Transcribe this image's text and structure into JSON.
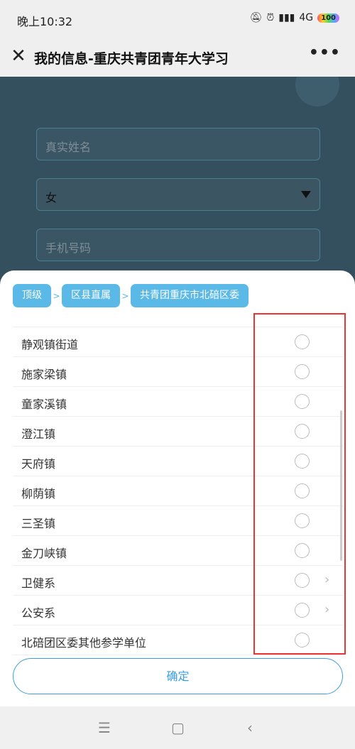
{
  "status": {
    "time": "晚上10:32",
    "network": "4G",
    "battery": "100"
  },
  "nav": {
    "title": "我的信息-重庆共青团青年大学习",
    "more": "•••"
  },
  "form": {
    "name_placeholder": "真实姓名",
    "gender_value": "女",
    "phone_placeholder": "手机号码"
  },
  "breadcrumbs": [
    "顶级",
    "区县直属",
    "共青团重庆市北碚区委"
  ],
  "breadcrumb_sep": ">",
  "list": [
    {
      "label": "静观镇街道",
      "has_children": false
    },
    {
      "label": "施家梁镇",
      "has_children": false
    },
    {
      "label": "童家溪镇",
      "has_children": false
    },
    {
      "label": "澄江镇",
      "has_children": false
    },
    {
      "label": "天府镇",
      "has_children": false
    },
    {
      "label": "柳荫镇",
      "has_children": false
    },
    {
      "label": "三圣镇",
      "has_children": false
    },
    {
      "label": "金刀峡镇",
      "has_children": false
    },
    {
      "label": "卫健系",
      "has_children": true
    },
    {
      "label": "公安系",
      "has_children": true
    },
    {
      "label": "北碚团区委其他参学单位",
      "has_children": false
    }
  ],
  "confirm_label": "确定",
  "colors": {
    "accent": "#5ab9e6",
    "button": "#3a9ee0",
    "highlight": "#e33333"
  }
}
